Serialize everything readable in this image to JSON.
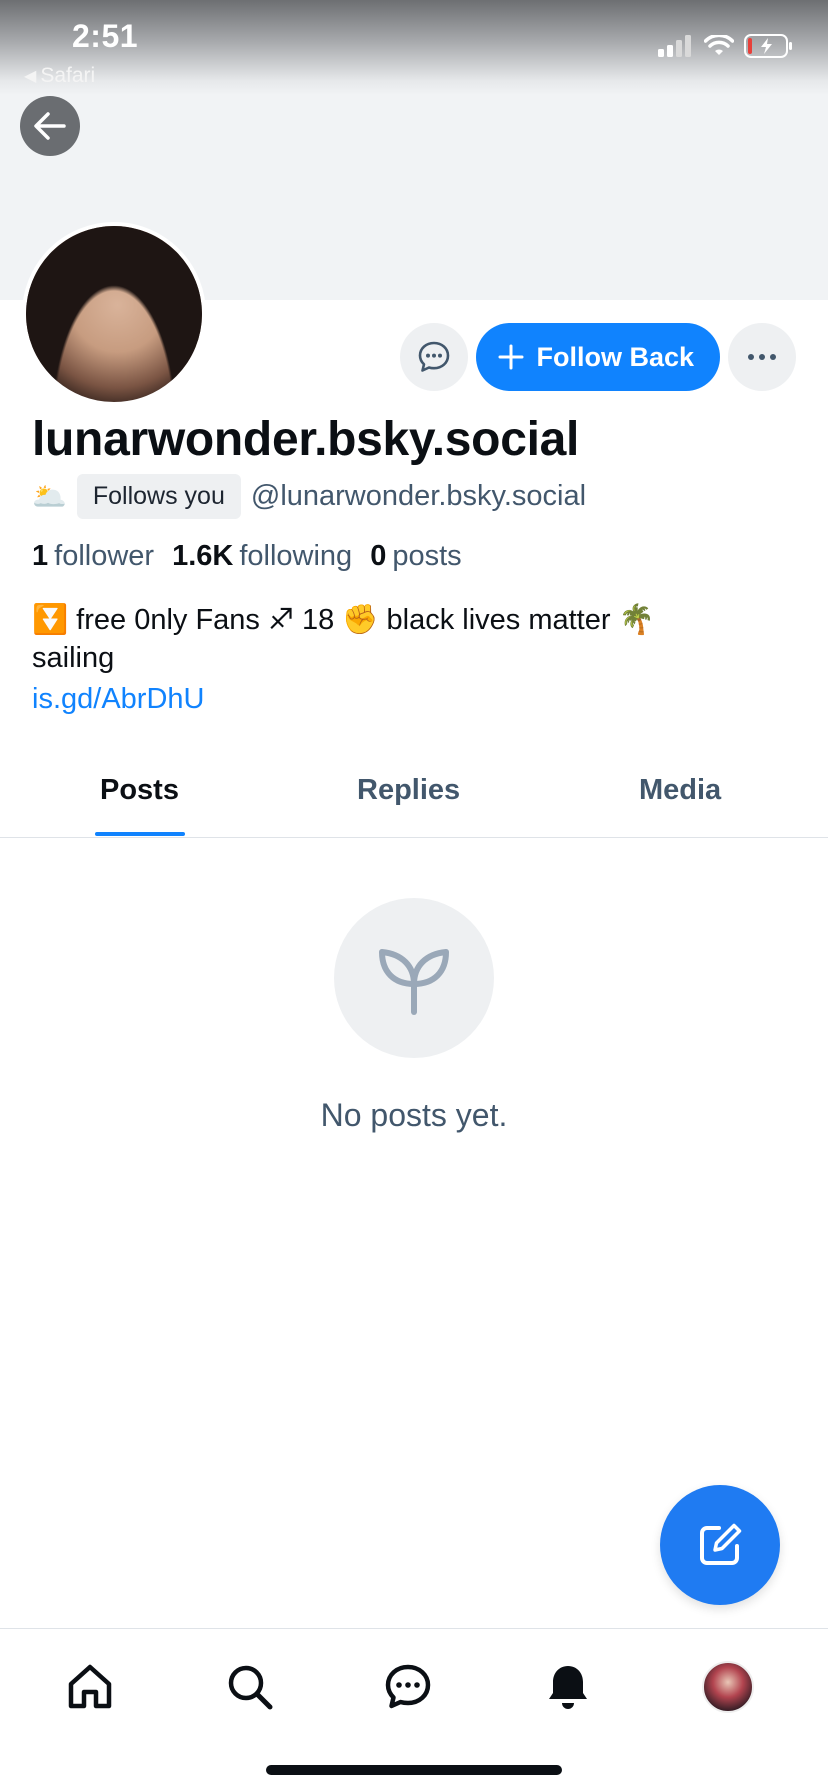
{
  "status_bar": {
    "time": "2:51",
    "back_app": "Safari"
  },
  "profile": {
    "display_name": "lunarwonder.bsky.social",
    "follows_you_label": "Follows you",
    "handle": "@lunarwonder.bsky.social",
    "stats": {
      "followers_count": "1",
      "followers_label": "follower",
      "following_count": "1.6K",
      "following_label": "following",
      "posts_count": "0",
      "posts_label": "posts"
    },
    "bio_line1": "⏬ free 0nly Fans ♐ 18 ✊ black lives matter 🌴",
    "bio_line2": "sailing",
    "bio_link": "is.gd/AbrDhU",
    "sun_emoji": "🌥️"
  },
  "actions": {
    "follow_back_label": "Follow Back"
  },
  "tabs": [
    {
      "label": "Posts",
      "active": true
    },
    {
      "label": "Replies",
      "active": false
    },
    {
      "label": "Media",
      "active": false
    }
  ],
  "empty_state": {
    "text": "No posts yet."
  },
  "colors": {
    "accent": "#1083fe",
    "fab": "#1f7bf2",
    "muted_text": "#42576c"
  },
  "icons": {
    "back": "arrow-left-icon",
    "message": "chat-bubble-icon",
    "more": "ellipsis-icon",
    "plus": "plus-icon",
    "empty": "sprout-icon",
    "compose": "compose-icon",
    "nav": [
      "home-icon",
      "search-icon",
      "chat-icon",
      "bell-icon",
      "profile-avatar"
    ]
  }
}
